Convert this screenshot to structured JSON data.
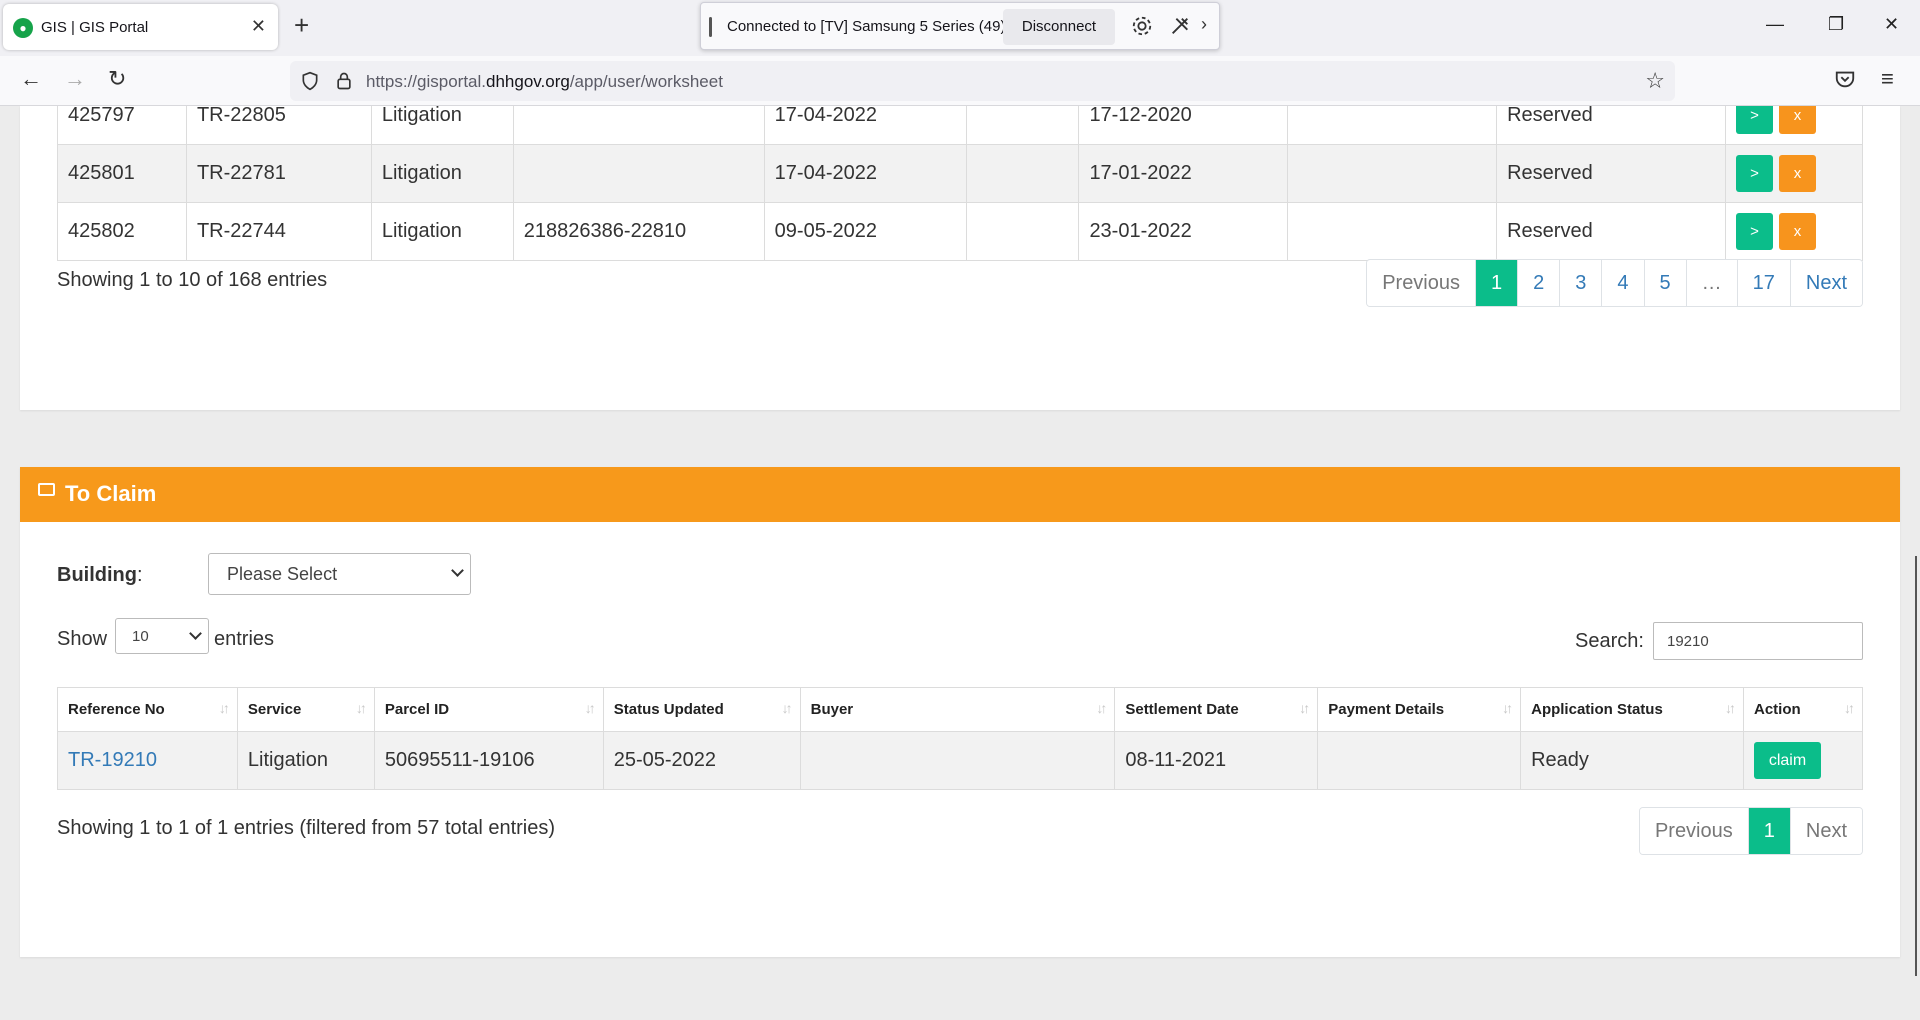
{
  "browser": {
    "tab_title": "GIS | GIS Portal",
    "cast_status": "Connected to [TV] Samsung 5 Series (49)",
    "cast_disconnect": "Disconnect",
    "url_prefix": "https://gisportal.",
    "url_domain": "dhhgov.org",
    "url_path": "/app/user/worksheet"
  },
  "worksheet": {
    "rows": [
      {
        "id": "425797",
        "ref": "TR-22805",
        "service": "Litigation",
        "parcel": "",
        "status_updated": "17-04-2022",
        "buyer": "",
        "settlement": "17-12-2020",
        "payment": "",
        "app_status": "Reserved"
      },
      {
        "id": "425801",
        "ref": "TR-22781",
        "service": "Litigation",
        "parcel": "",
        "status_updated": "17-04-2022",
        "buyer": "",
        "settlement": "17-01-2022",
        "payment": "",
        "app_status": "Reserved"
      },
      {
        "id": "425802",
        "ref": "TR-22744",
        "service": "Litigation",
        "parcel": "218826386-22810",
        "status_updated": "09-05-2022",
        "buyer": "",
        "settlement": "23-01-2022",
        "payment": "",
        "app_status": "Reserved"
      }
    ],
    "action_forward": ">",
    "action_remove": "x",
    "info": "Showing 1 to 10 of 168 entries",
    "pagination": {
      "previous": "Previous",
      "pages": [
        "1",
        "2",
        "3",
        "4",
        "5",
        "…",
        "17"
      ],
      "next": "Next",
      "active": "1"
    }
  },
  "to_claim": {
    "title": "To Claim",
    "building_label": "Building",
    "building_colon": ":",
    "building_select": "Please Select",
    "show_label": "Show",
    "show_value": "10",
    "entries_label": "entries",
    "search_label": "Search:",
    "search_value": "19210",
    "headers": [
      "Reference No",
      "Service",
      "Parcel ID",
      "Status Updated",
      "Buyer",
      "Settlement Date",
      "Payment Details",
      "Application Status",
      "Action"
    ],
    "rows": [
      {
        "ref": "TR-19210",
        "service": "Litigation",
        "parcel": "50695511-19106",
        "status_updated": "25-05-2022",
        "buyer": "",
        "settlement": "08-11-2021",
        "payment": "",
        "app_status": "Ready",
        "action": "claim"
      }
    ],
    "info": "Showing 1 to 1 of 1 entries (filtered from 57 total entries)",
    "pagination": {
      "previous": "Previous",
      "active": "1",
      "next": "Next"
    }
  },
  "colors": {
    "accent_green": "#0bbd8a",
    "accent_orange": "#f7941d",
    "link_blue": "#337ab7"
  }
}
